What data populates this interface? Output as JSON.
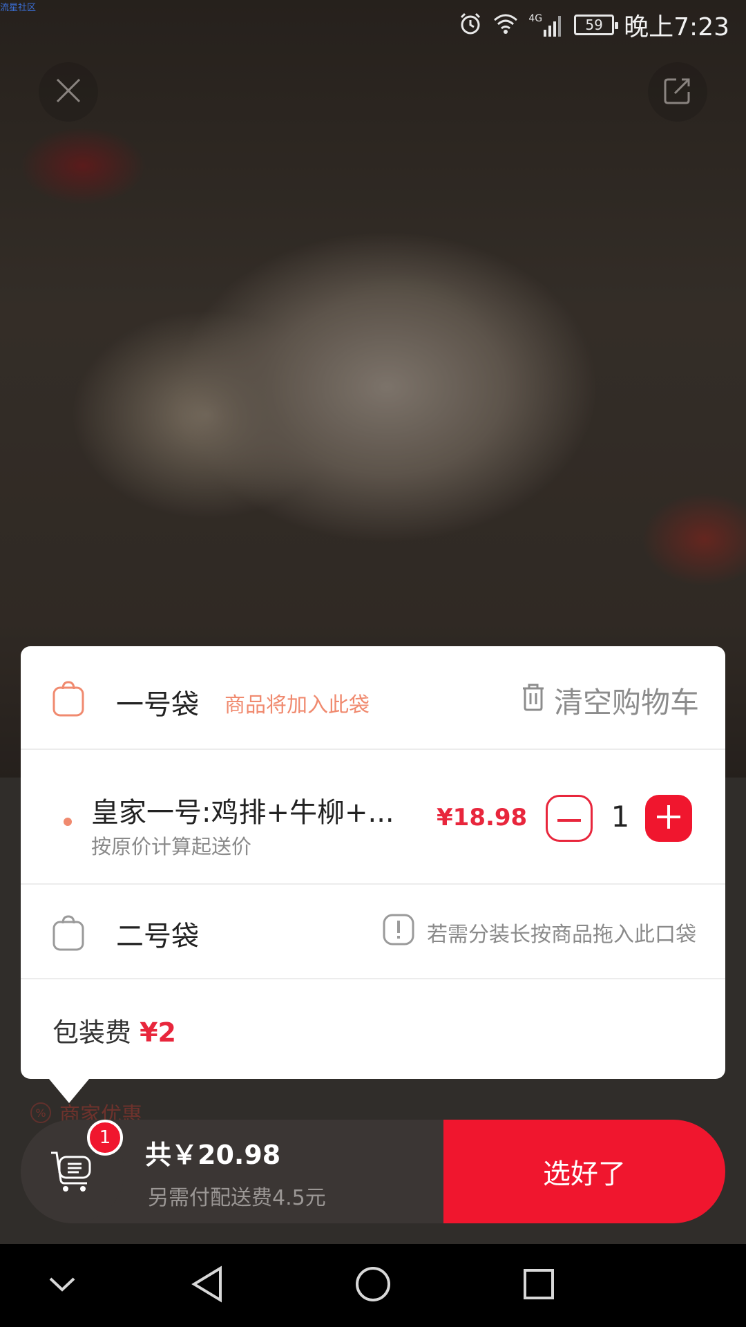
{
  "watermark": "流星社区",
  "status_bar": {
    "time": "晚上7:23",
    "battery": "59",
    "network": "4G",
    "icons": [
      "alarm-icon",
      "wifi-icon",
      "signal-icon",
      "battery-icon"
    ]
  },
  "top_actions": [
    "close-icon",
    "share-icon"
  ],
  "background": {
    "discount_label": "商家优惠",
    "discount_icon": "%"
  },
  "cart": {
    "bag1": {
      "title": "一号袋",
      "note": "商品将加入此袋",
      "clear_label": "清空购物车"
    },
    "items": [
      {
        "name": "皇家一号:鸡排+牛柳+...",
        "note": "按原价计算起送价",
        "price": "¥18.98",
        "quantity": "1"
      }
    ],
    "bag2": {
      "title": "二号袋",
      "hint": "若需分装长按商品拖入此口袋"
    },
    "packaging_fee": {
      "label": "包装费",
      "value": "¥2"
    }
  },
  "bottom_bar": {
    "badge_count": "1",
    "total": "共￥20.98",
    "delivery_note": "另需付配送费4.5元",
    "confirm_label": "选好了"
  },
  "colors": {
    "accent_red": "#f0162e",
    "price_red": "#e8263c",
    "bag_orange": "#f08a6f",
    "bar_dark": "#3b3634"
  },
  "nav_bar": [
    "back-chevron-icon",
    "back-triangle-icon",
    "home-circle-icon",
    "recents-square-icon"
  ]
}
